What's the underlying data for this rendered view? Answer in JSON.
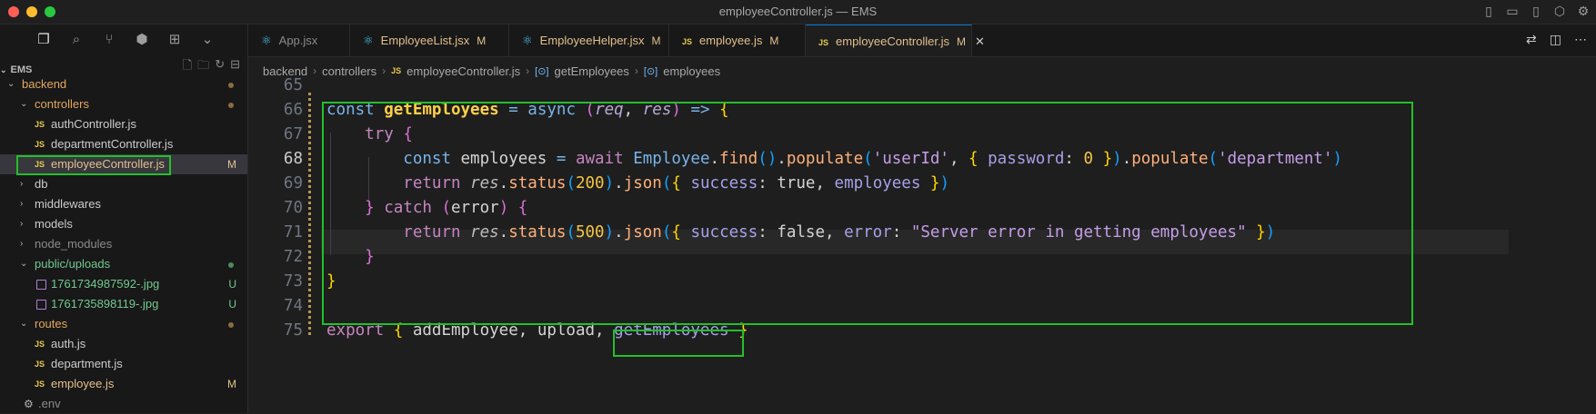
{
  "window": {
    "title": "employeeController.js — EMS"
  },
  "explorer": {
    "project": "EMS",
    "items": [
      {
        "label": "backend",
        "type": "folder",
        "open": true,
        "depth": 0,
        "status": "dot",
        "color": "#e2a85f"
      },
      {
        "label": "controllers",
        "type": "folder",
        "open": true,
        "depth": 1,
        "status": "dot",
        "color": "#e2a85f"
      },
      {
        "label": "authController.js",
        "type": "js",
        "depth": 2,
        "status": "",
        "color": "#cccccc"
      },
      {
        "label": "departmentController.js",
        "type": "js",
        "depth": 2,
        "status": "",
        "color": "#cccccc"
      },
      {
        "label": "employeeController.js",
        "type": "js",
        "depth": 2,
        "status": "M",
        "color": "#e2c08d",
        "selected": true
      },
      {
        "label": "db",
        "type": "folder",
        "open": false,
        "depth": 1,
        "status": "",
        "color": "#cccccc"
      },
      {
        "label": "middlewares",
        "type": "folder",
        "open": false,
        "depth": 1,
        "status": "",
        "color": "#cccccc"
      },
      {
        "label": "models",
        "type": "folder",
        "open": false,
        "depth": 1,
        "status": "",
        "color": "#cccccc"
      },
      {
        "label": "node_modules",
        "type": "folder",
        "open": false,
        "depth": 1,
        "status": "",
        "color": "#8b8b8b"
      },
      {
        "label": "public/uploads",
        "type": "folder",
        "open": true,
        "depth": 1,
        "status": "dot-green",
        "color": "#73c991"
      },
      {
        "label": "1761734987592-.jpg",
        "type": "img",
        "depth": 2,
        "status": "U",
        "color": "#73c991"
      },
      {
        "label": "1761735898119-.jpg",
        "type": "img",
        "depth": 2,
        "status": "U",
        "color": "#73c991"
      },
      {
        "label": "routes",
        "type": "folder",
        "open": true,
        "depth": 1,
        "status": "dot",
        "color": "#e2a85f"
      },
      {
        "label": "auth.js",
        "type": "js",
        "depth": 2,
        "status": "",
        "color": "#cccccc"
      },
      {
        "label": "department.js",
        "type": "js",
        "depth": 2,
        "status": "",
        "color": "#cccccc"
      },
      {
        "label": "employee.js",
        "type": "js",
        "depth": 2,
        "status": "M",
        "color": "#e2c08d"
      },
      {
        "label": ".env",
        "type": "gear",
        "depth": 1,
        "status": "",
        "color": "#8b8b8b"
      }
    ]
  },
  "tabs": [
    {
      "label": "App.jsx",
      "icon": "react-icon",
      "modified": "",
      "color": "#8b8b8b"
    },
    {
      "label": "EmployeeList.jsx",
      "icon": "react-icon",
      "modified": "M",
      "color": "#e2c08d"
    },
    {
      "label": "EmployeeHelper.jsx",
      "icon": "react-icon",
      "modified": "M",
      "color": "#e2c08d"
    },
    {
      "label": "employee.js",
      "icon": "js-icon",
      "modified": "M",
      "color": "#e2c08d"
    },
    {
      "label": "employeeController.js",
      "icon": "js-icon",
      "modified": "M",
      "color": "#e2c08d",
      "active": true
    }
  ],
  "breadcrumb": [
    "backend",
    "controllers",
    "employeeController.js",
    "getEmployees",
    "employees"
  ],
  "editor": {
    "line_numbers": [
      "65",
      "66",
      "67",
      "68",
      "69",
      "70",
      "71",
      "72",
      "73",
      "74",
      "75"
    ],
    "current_line": "68",
    "lines": [
      [],
      [
        [
          "kw",
          "const "
        ],
        [
          "fn",
          "getEmployees"
        ],
        [
          "var",
          " "
        ],
        [
          "op",
          "="
        ],
        [
          "var",
          " "
        ],
        [
          "kw",
          "async "
        ],
        [
          "br2",
          "("
        ],
        [
          "pa",
          "req"
        ],
        [
          "var",
          ", "
        ],
        [
          "pa",
          "res"
        ],
        [
          "br2",
          ")"
        ],
        [
          "var",
          " "
        ],
        [
          "op",
          "=>"
        ],
        [
          "var",
          " "
        ],
        [
          "br1",
          "{"
        ]
      ],
      [
        [
          "var",
          "    "
        ],
        [
          "kwp",
          "try "
        ],
        [
          "br2",
          "{"
        ]
      ],
      [
        [
          "var",
          "        "
        ],
        [
          "kw",
          "const "
        ],
        [
          "var",
          "employees "
        ],
        [
          "op",
          "="
        ],
        [
          "var",
          " "
        ],
        [
          "kwp",
          "await "
        ],
        [
          "cls",
          "Employee"
        ],
        [
          "var",
          "."
        ],
        [
          "call",
          "find"
        ],
        [
          "br3",
          "()"
        ],
        [
          "var",
          "."
        ],
        [
          "call",
          "populate"
        ],
        [
          "br3",
          "("
        ],
        [
          "str",
          "'userId'"
        ],
        [
          "var",
          ", "
        ],
        [
          "br1",
          "{"
        ],
        [
          "var",
          " "
        ],
        [
          "prop",
          "password"
        ],
        [
          "var",
          ": "
        ],
        [
          "num",
          "0"
        ],
        [
          "var",
          " "
        ],
        [
          "br1",
          "}"
        ],
        [
          "br3",
          ")"
        ],
        [
          "var",
          "."
        ],
        [
          "call",
          "populate"
        ],
        [
          "br3",
          "("
        ],
        [
          "str",
          "'department'"
        ],
        [
          "br3",
          ")"
        ]
      ],
      [
        [
          "var",
          "        "
        ],
        [
          "kwp",
          "return "
        ],
        [
          "it",
          "res"
        ],
        [
          "var",
          "."
        ],
        [
          "call",
          "status"
        ],
        [
          "br3",
          "("
        ],
        [
          "num",
          "200"
        ],
        [
          "br3",
          ")"
        ],
        [
          "var",
          "."
        ],
        [
          "call",
          "json"
        ],
        [
          "br3",
          "("
        ],
        [
          "br1",
          "{"
        ],
        [
          "var",
          " "
        ],
        [
          "prop",
          "success"
        ],
        [
          "var",
          ": true, "
        ],
        [
          "prop",
          "employees"
        ],
        [
          "var",
          " "
        ],
        [
          "br1",
          "}"
        ],
        [
          "br3",
          ")"
        ]
      ],
      [
        [
          "var",
          "    "
        ],
        [
          "br2",
          "}"
        ],
        [
          "var",
          " "
        ],
        [
          "kwp",
          "catch "
        ],
        [
          "br2",
          "("
        ],
        [
          "var",
          "error"
        ],
        [
          "br2",
          ")"
        ],
        [
          "var",
          " "
        ],
        [
          "br2",
          "{"
        ]
      ],
      [
        [
          "var",
          "        "
        ],
        [
          "kwp",
          "return "
        ],
        [
          "it",
          "res"
        ],
        [
          "var",
          "."
        ],
        [
          "call",
          "status"
        ],
        [
          "br3",
          "("
        ],
        [
          "num",
          "500"
        ],
        [
          "br3",
          ")"
        ],
        [
          "var",
          "."
        ],
        [
          "call",
          "json"
        ],
        [
          "br3",
          "("
        ],
        [
          "br1",
          "{"
        ],
        [
          "var",
          " "
        ],
        [
          "prop",
          "success"
        ],
        [
          "var",
          ": false, "
        ],
        [
          "prop",
          "error"
        ],
        [
          "var",
          ": "
        ],
        [
          "str",
          "\"Server error in getting employees\""
        ],
        [
          "var",
          " "
        ],
        [
          "br1",
          "}"
        ],
        [
          "br3",
          ")"
        ]
      ],
      [
        [
          "var",
          "    "
        ],
        [
          "br2",
          "}"
        ]
      ],
      [
        [
          "br1",
          "}"
        ]
      ],
      [],
      [
        [
          "kwp",
          "export "
        ],
        [
          "br1",
          "{"
        ],
        [
          "var",
          " addEmployee, upload, "
        ],
        [
          "prop",
          "getEmployees"
        ],
        [
          "var",
          " "
        ],
        [
          "br1",
          "}"
        ]
      ]
    ]
  }
}
